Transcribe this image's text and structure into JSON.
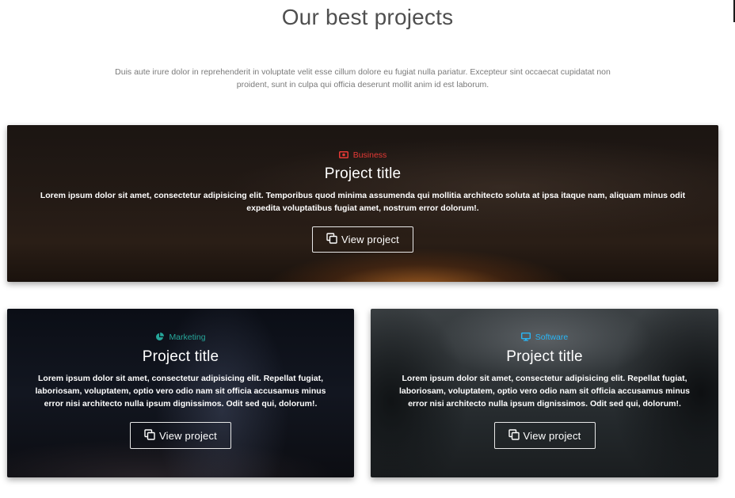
{
  "section": {
    "title": "Our best projects",
    "description": "Duis aute irure dolor in reprehenderit in voluptate velit esse cillum dolore eu fugiat nulla pariatur. Excepteur sint occaecat cupidatat non proident, sunt in culpa qui officia deserunt mollit anim id est laborum."
  },
  "colors": {
    "business": "#e53935",
    "marketing": "#26a69a",
    "software": "#29b6f6",
    "title_text": "#4f4f4f",
    "muted_text": "#7a7a7a"
  },
  "projects": [
    {
      "category": "Business",
      "category_icon": "money-bill-icon",
      "title": "Project title",
      "text": "Lorem ipsum dolor sit amet, consectetur adipisicing elit. Temporibus quod minima assumenda qui mollitia architecto soluta at ipsa itaque nam, aliquam minus odit expedita voluptatibus fugiat amet, nostrum error dolorum!.",
      "button_label": "View project",
      "button_icon": "copy-icon"
    },
    {
      "category": "Marketing",
      "category_icon": "chart-pie-icon",
      "title": "Project title",
      "text": "Lorem ipsum dolor sit amet, consectetur adipisicing elit. Repellat fugiat, laboriosam, voluptatem, optio vero odio nam sit officia accusamus minus error nisi architecto nulla ipsum dignissimos. Odit sed qui, dolorum!.",
      "button_label": "View project",
      "button_icon": "copy-icon"
    },
    {
      "category": "Software",
      "category_icon": "desktop-icon",
      "title": "Project title",
      "text": "Lorem ipsum dolor sit amet, consectetur adipisicing elit. Repellat fugiat, laboriosam, voluptatem, optio vero odio nam sit officia accusamus minus error nisi architecto nulla ipsum dignissimos. Odit sed qui, dolorum!.",
      "button_label": "View project",
      "button_icon": "copy-icon"
    }
  ]
}
